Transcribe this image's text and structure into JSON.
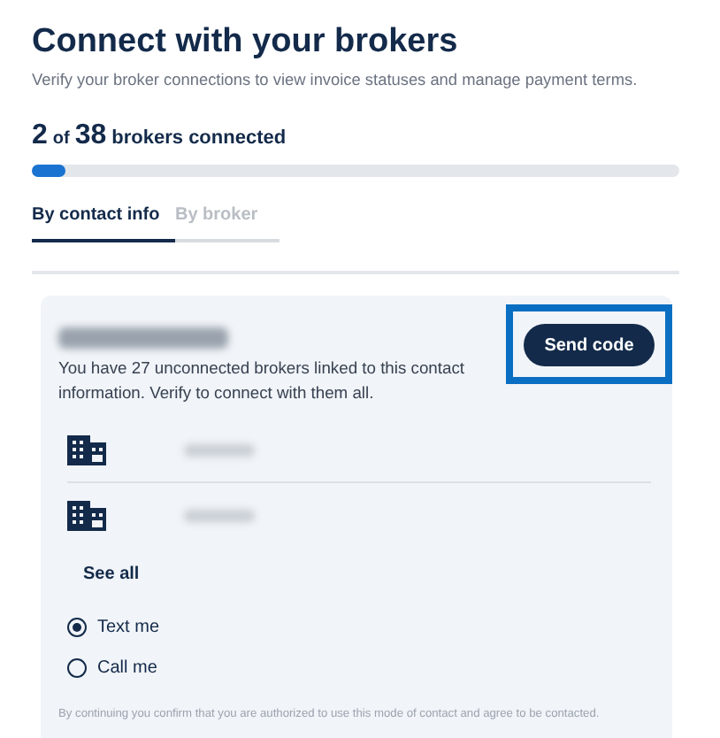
{
  "header": {
    "title": "Connect with your brokers",
    "subtitle": "Verify your broker connections to view invoice statuses and manage payment terms."
  },
  "progress": {
    "connected": "2",
    "of": "of",
    "total": "38",
    "label": "brokers connected",
    "level": 0.052
  },
  "tabs": [
    {
      "label": "By contact info",
      "selected": true
    },
    {
      "label": "By broker",
      "selected": false
    }
  ],
  "contact_card": {
    "contact_redacted": true,
    "message": "You have 27 unconnected brokers linked to this contact information. Verify to connect with them all.",
    "send_button": {
      "label": "Send code",
      "highlighted": true
    },
    "brokers": [
      {
        "name_redacted": true
      },
      {
        "name_redacted": true
      }
    ],
    "see_all": "See all",
    "options": [
      {
        "label": "Text me",
        "selected": true
      },
      {
        "label": "Call me",
        "selected": false
      }
    ],
    "disclaimer": "By continuing you confirm that you are authorized to use this mode of contact and agree to be contacted."
  }
}
